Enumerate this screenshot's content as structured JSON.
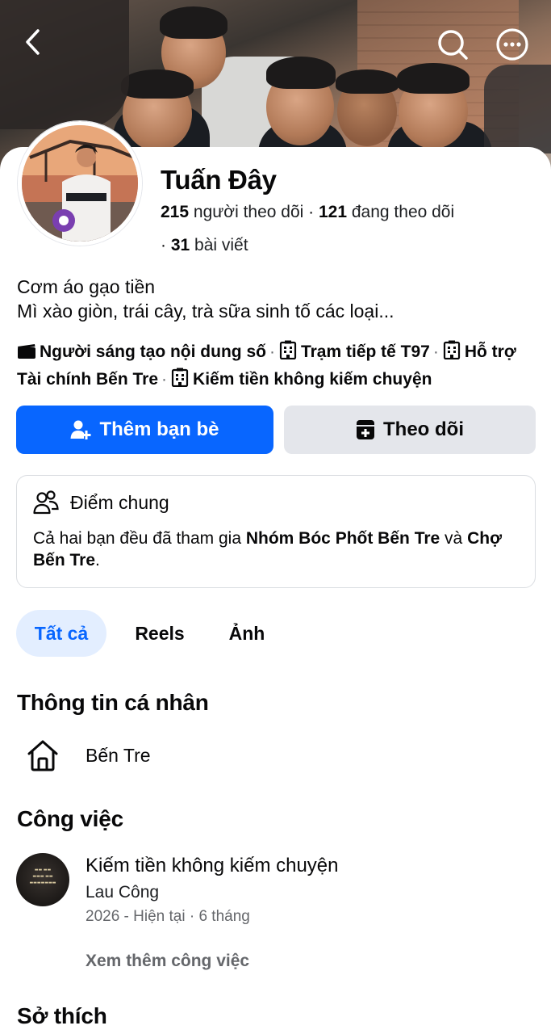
{
  "profile": {
    "name": "Tuấn Đây",
    "followers_count": "215",
    "followers_label": "người theo dõi",
    "following_count": "121",
    "following_label": "đang theo dõi",
    "posts_count": "31",
    "posts_label": "bài viết",
    "bio_line1": "Cơm áo gạo tiền",
    "bio_line2": "Mì xào giòn, trái cây, trà sữa sinh tố các loại..."
  },
  "tags": [
    {
      "label": "Người sáng tạo nội dung số",
      "icon": "clapperboard-icon"
    },
    {
      "label": "Trạm tiếp tế T97",
      "icon": "building-icon"
    },
    {
      "label": "Hỗ trợ Tài chính Bến Tre",
      "icon": "building-icon"
    },
    {
      "label": "Kiếm tiền không kiếm chuyện",
      "icon": "building-icon"
    }
  ],
  "actions": {
    "add_friend_label": "Thêm bạn bè",
    "follow_label": "Theo dõi"
  },
  "mutual": {
    "title": "Điểm chung",
    "text_prefix": "Cả hai bạn đều đã tham gia ",
    "group1": "Nhóm Bóc Phốt Bến Tre",
    "text_mid": " và ",
    "group2": "Chợ Bến Tre",
    "text_suffix": "."
  },
  "tabs": [
    {
      "label": "Tất cả",
      "active": true
    },
    {
      "label": "Reels",
      "active": false
    },
    {
      "label": "Ảnh",
      "active": false
    }
  ],
  "personal_info": {
    "title": "Thông tin cá nhân",
    "hometown": "Bến Tre"
  },
  "work": {
    "title": "Công việc",
    "company": "Kiếm tiền không kiếm chuyện",
    "role": "Lau Công",
    "period": "2026 - Hiện tại · 6 tháng",
    "see_more": "Xem thêm công việc"
  },
  "hobbies": {
    "title": "Sở thích"
  },
  "colors": {
    "primary": "#0866ff",
    "secondary_button": "#e4e6eb",
    "active_tab_bg": "#e3eeff",
    "muted": "#65676b"
  }
}
